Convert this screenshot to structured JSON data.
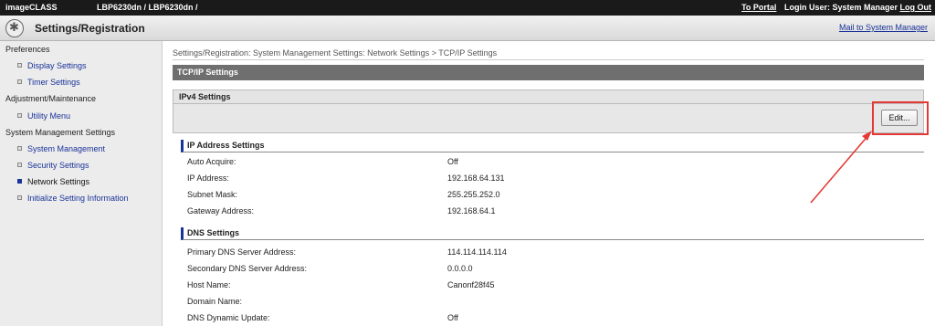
{
  "topbar": {
    "brand": "imageCLASS",
    "model": "LBP6230dn / LBP6230dn /",
    "to_portal": "To Portal",
    "login_user": "Login User: System Manager",
    "log_out": "Log Out"
  },
  "header": {
    "title": "Settings/Registration",
    "mail_link": "Mail to System Manager"
  },
  "sidebar": {
    "sections": [
      "Preferences",
      "Adjustment/Maintenance",
      "System Management Settings"
    ],
    "items": [
      {
        "label": "Display Settings"
      },
      {
        "label": "Timer Settings"
      },
      {
        "label": "Utility Menu"
      },
      {
        "label": "System Management"
      },
      {
        "label": "Security Settings"
      },
      {
        "label": "Network Settings",
        "active": true
      },
      {
        "label": "Initialize Setting Information"
      }
    ]
  },
  "main": {
    "breadcrumb": "Settings/Registration: System Management Settings: Network Settings > TCP/IP Settings",
    "section_title": "TCP/IP Settings",
    "subsection_title": "IPv4 Settings",
    "edit_label": "Edit...",
    "ip_group": {
      "title": "IP Address Settings",
      "rows": [
        {
          "label": "Auto Acquire:",
          "value": "Off"
        },
        {
          "label": "IP Address:",
          "value": "192.168.64.131"
        },
        {
          "label": "Subnet Mask:",
          "value": "255.255.252.0"
        },
        {
          "label": "Gateway Address:",
          "value": "192.168.64.1"
        }
      ]
    },
    "dns_group": {
      "title": "DNS Settings",
      "rows": [
        {
          "label": "Primary DNS Server Address:",
          "value": "114.114.114.114"
        },
        {
          "label": "Secondary DNS Server Address:",
          "value": "0.0.0.0"
        },
        {
          "label": "Host Name:",
          "value": "Canonf28f45"
        },
        {
          "label": "Domain Name:",
          "value": ""
        },
        {
          "label": "DNS Dynamic Update:",
          "value": "Off"
        }
      ]
    }
  },
  "colors": {
    "link": "#1a3399",
    "highlight": "#e53935",
    "section_bar": "#6f6f6f"
  }
}
